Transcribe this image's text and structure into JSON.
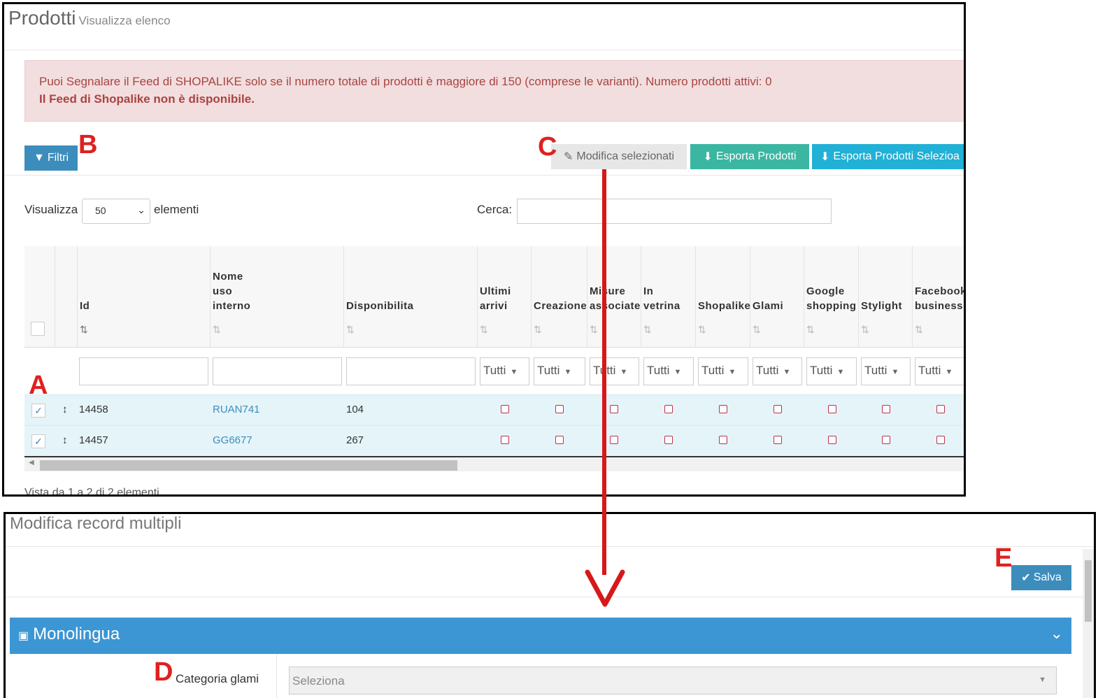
{
  "products": {
    "title": "Prodotti",
    "subtitle": "Visualizza elenco",
    "alert": {
      "line1": "Puoi Segnalare il Feed di SHOPALIKE solo se il numero totale di prodotti è maggiore di 150 (comprese le varianti). Numero prodotti attivi: 0",
      "line2": "Il Feed di Shopalike non è disponibile."
    },
    "buttons": {
      "filters": "Filtri",
      "edit_selected": "Modifica selezionati",
      "export": "Esporta Prodotti",
      "export_selected": "Esporta Prodotti Selezioa"
    },
    "length": {
      "prefix": "Visualizza",
      "value": "50",
      "suffix": "elementi"
    },
    "search_label": "Cerca:",
    "columns": [
      "Id",
      "Nome\nuso\ninterno",
      "Disponibilita",
      "Ultimi\narrivi",
      "Creazione",
      "Misure\nassociate",
      "In\nvetrina",
      "Shopalike",
      "Glami",
      "Google\nshopping",
      "Stylight",
      "Facebook\nbusiness"
    ],
    "filter_all": "Tutti",
    "rows": [
      {
        "id": "14458",
        "name": "RUAN741",
        "stock": "104"
      },
      {
        "id": "14457",
        "name": "GG6677",
        "stock": "267"
      }
    ],
    "footer": "Vista da 1 a 2 di 2 elementi"
  },
  "modal": {
    "title": "Modifica record multipli",
    "save": "Salva",
    "section": "Monolingua",
    "field_label": "Categoria glami",
    "field_placeholder": "Seleziona"
  },
  "markers": {
    "a": "A",
    "b": "B",
    "c": "C",
    "d": "D",
    "e": "E"
  },
  "colors": {
    "primary": "#3c8dbc",
    "export": "#3bb6a2",
    "export_selected": "#21b0d6",
    "alert_bg": "#f2dede",
    "alert_text": "#a94442",
    "annotation": "#e02020",
    "row_bg": "#e5f4f9"
  }
}
